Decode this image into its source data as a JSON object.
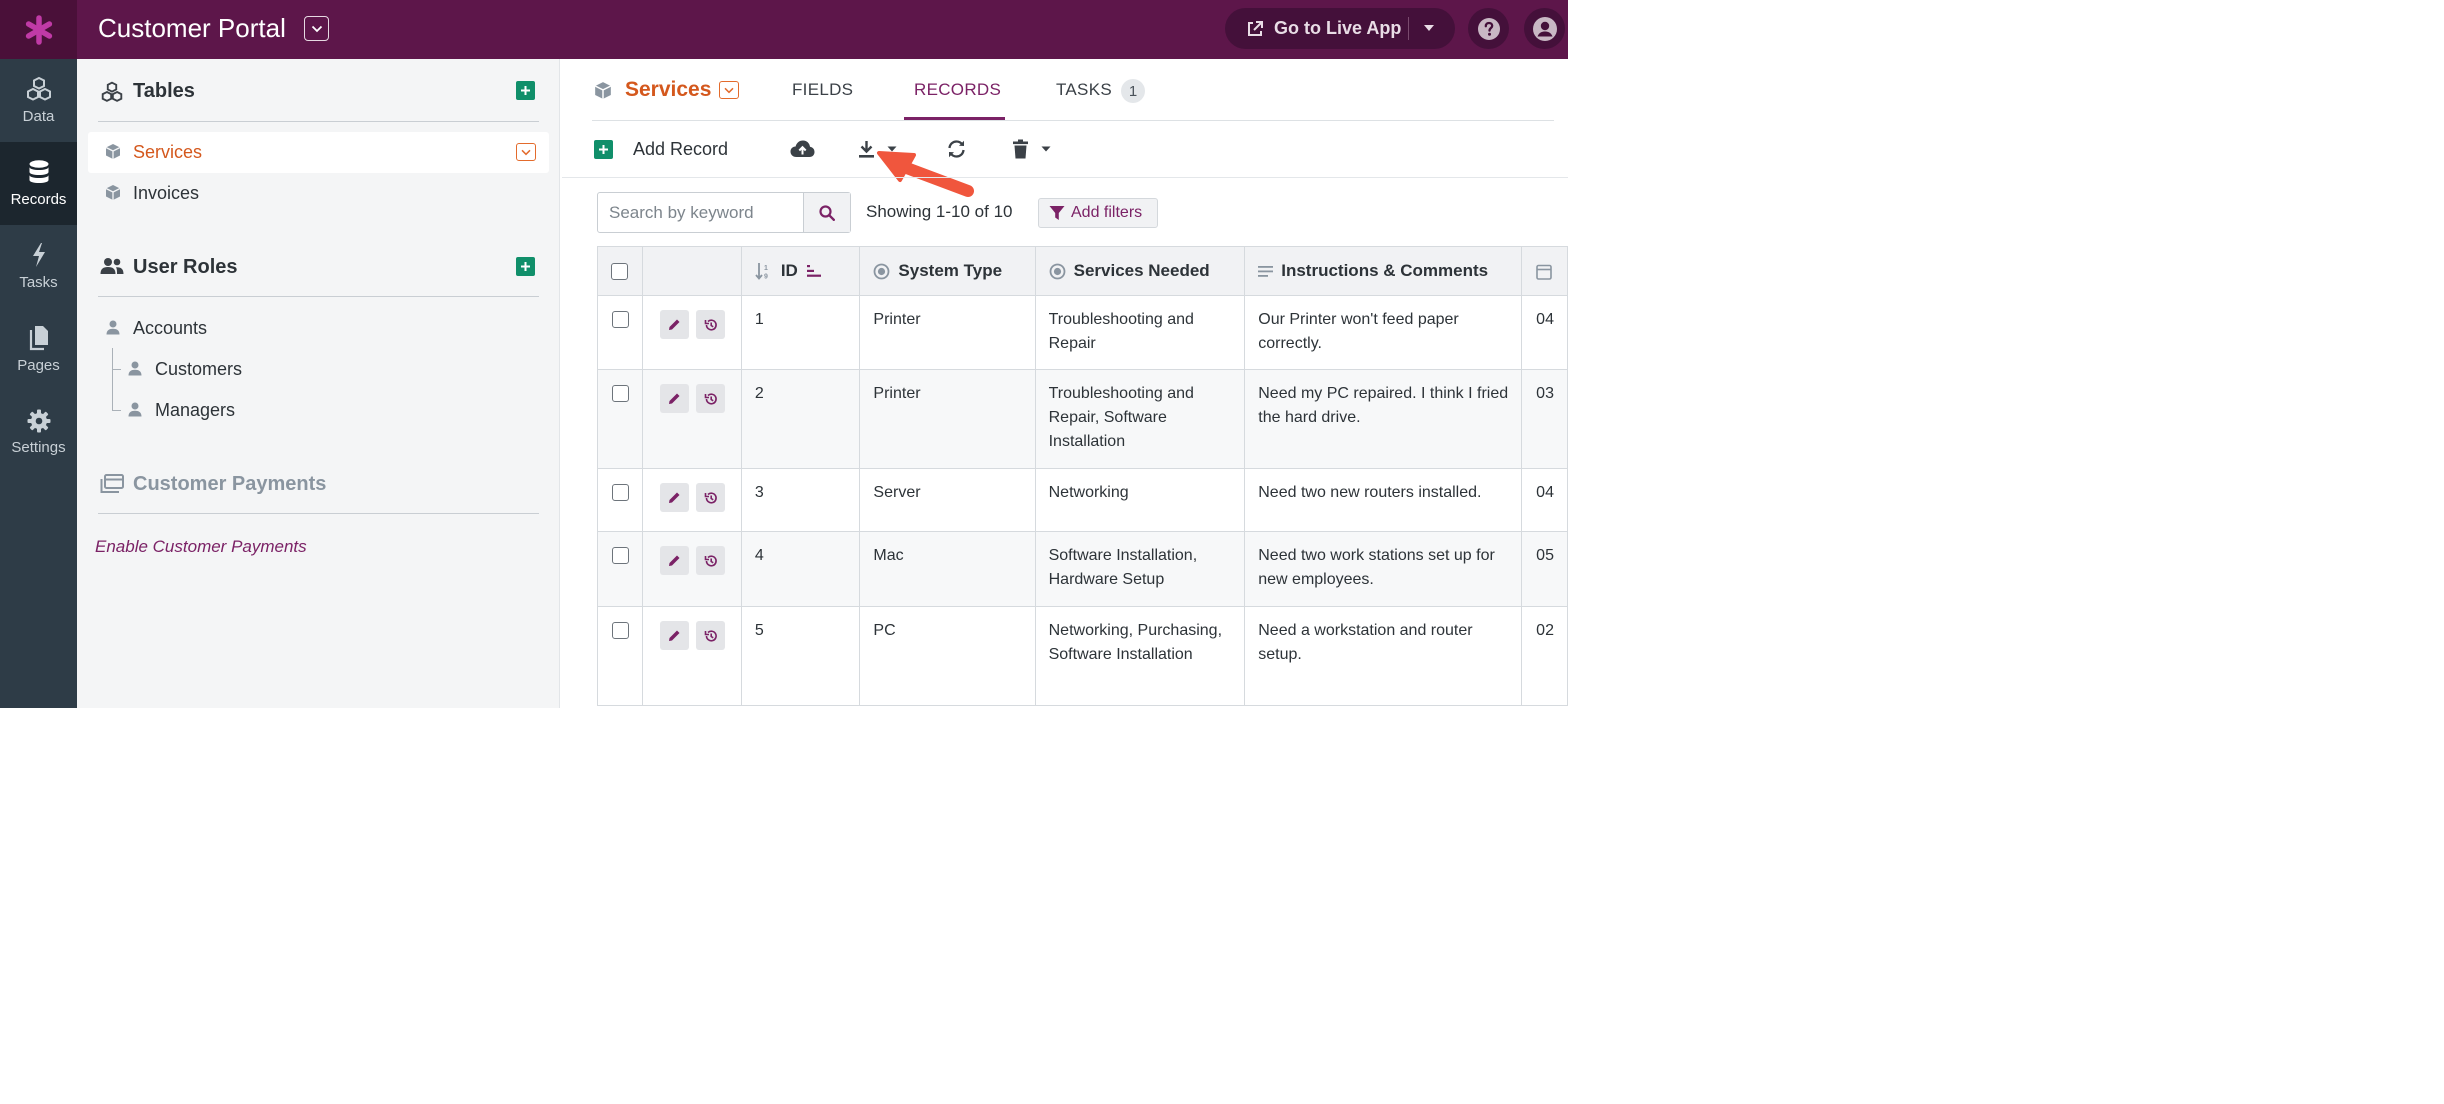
{
  "app": {
    "title": "Customer Portal",
    "live_button": "Go to Live App"
  },
  "nav": [
    {
      "label": "Data",
      "icon": "cubes-icon"
    },
    {
      "label": "Records",
      "icon": "database-icon"
    },
    {
      "label": "Tasks",
      "icon": "bolt-icon"
    },
    {
      "label": "Pages",
      "icon": "pages-icon"
    },
    {
      "label": "Settings",
      "icon": "gear-icon"
    }
  ],
  "sidebar": {
    "tables_title": "Tables",
    "tables": [
      "Services",
      "Invoices"
    ],
    "roles_title": "User Roles",
    "roles": [
      "Accounts",
      "Customers",
      "Managers"
    ],
    "payments_title": "Customer Payments",
    "payments_link": "Enable Customer Payments"
  },
  "main": {
    "object_name": "Services",
    "tabs": [
      "FIELDS",
      "RECORDS",
      "TASKS"
    ],
    "tasks_count": "1",
    "add_record": "Add Record",
    "search_placeholder": "Search by keyword",
    "showing": "Showing 1-10 of 10",
    "add_filters": "Add filters"
  },
  "table": {
    "columns": [
      "ID",
      "System Type",
      "Services Needed",
      "Instructions & Comments"
    ],
    "rows": [
      {
        "id": "1",
        "system": "Printer",
        "services": "Troubleshooting and Repair",
        "comments": "Our Printer won't feed paper correctly.",
        "date": "04"
      },
      {
        "id": "2",
        "system": "Printer",
        "services": "Troubleshooting and Repair, Software Installation",
        "comments": "Need my PC repaired. I think I fried the hard drive.",
        "date": "03"
      },
      {
        "id": "3",
        "system": "Server",
        "services": "Networking",
        "comments": "Need two new routers installed.",
        "date": "04"
      },
      {
        "id": "4",
        "system": "Mac",
        "services": "Software Installation, Hardware Setup",
        "comments": "Need two work stations set up for new employees.",
        "date": "05"
      },
      {
        "id": "5",
        "system": "PC",
        "services": "Networking, Purchasing, Software Installation",
        "comments": "Need a workstation and router setup.",
        "date": "02"
      }
    ]
  },
  "colors": {
    "brand": "#5d164a",
    "accent": "#7b2266",
    "orange": "#d4581d",
    "green": "#108f6a",
    "annotation_arrow": "#f0563d"
  }
}
